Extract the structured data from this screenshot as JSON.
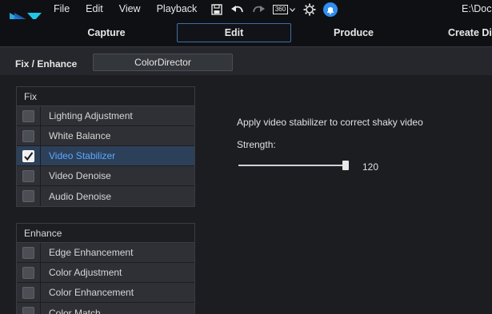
{
  "menu": {
    "items": [
      "File",
      "Edit",
      "View",
      "Playback"
    ],
    "toolbar_icons": [
      "save-icon",
      "undo-icon",
      "redo-icon",
      "360-icon",
      "settings-icon",
      "notification-icon"
    ],
    "badge_360": "360",
    "project_path": "E:\\Docu"
  },
  "modes": {
    "tabs": [
      "Capture",
      "Edit",
      "Produce",
      "Create Dis"
    ],
    "active": "Edit"
  },
  "room": {
    "title": "Fix / Enhance",
    "colordirector_label": "ColorDirector"
  },
  "fix_group": {
    "header": "Fix",
    "items": [
      {
        "label": "Lighting Adjustment",
        "checked": false
      },
      {
        "label": "White Balance",
        "checked": false
      },
      {
        "label": "Video Stabilizer",
        "checked": true
      },
      {
        "label": "Video Denoise",
        "checked": false
      },
      {
        "label": "Audio Denoise",
        "checked": false
      }
    ]
  },
  "enhance_group": {
    "header": "Enhance",
    "items": [
      {
        "label": "Edge Enhancement",
        "checked": false
      },
      {
        "label": "Color Adjustment",
        "checked": false
      },
      {
        "label": "Color Enhancement",
        "checked": false
      },
      {
        "label": "Color Match",
        "checked": false
      }
    ]
  },
  "settings": {
    "description": "Apply video stabilizer to correct shaky video",
    "strength_label": "Strength:",
    "strength_value": "120",
    "strength_min": 0,
    "strength_max": 120
  },
  "colors": {
    "accent": "#3d6fa8",
    "selected_text": "#5aa8ff",
    "selected_row": "#2d4059"
  }
}
